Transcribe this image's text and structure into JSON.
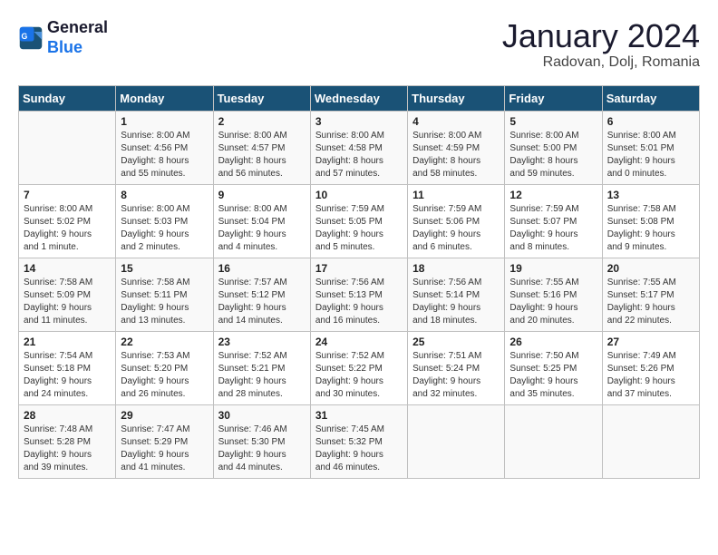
{
  "header": {
    "logo_line1": "General",
    "logo_line2": "Blue",
    "month": "January 2024",
    "location": "Radovan, Dolj, Romania"
  },
  "days_of_week": [
    "Sunday",
    "Monday",
    "Tuesday",
    "Wednesday",
    "Thursday",
    "Friday",
    "Saturday"
  ],
  "weeks": [
    [
      {
        "day": "",
        "info": ""
      },
      {
        "day": "1",
        "info": "Sunrise: 8:00 AM\nSunset: 4:56 PM\nDaylight: 8 hours\nand 55 minutes."
      },
      {
        "day": "2",
        "info": "Sunrise: 8:00 AM\nSunset: 4:57 PM\nDaylight: 8 hours\nand 56 minutes."
      },
      {
        "day": "3",
        "info": "Sunrise: 8:00 AM\nSunset: 4:58 PM\nDaylight: 8 hours\nand 57 minutes."
      },
      {
        "day": "4",
        "info": "Sunrise: 8:00 AM\nSunset: 4:59 PM\nDaylight: 8 hours\nand 58 minutes."
      },
      {
        "day": "5",
        "info": "Sunrise: 8:00 AM\nSunset: 5:00 PM\nDaylight: 8 hours\nand 59 minutes."
      },
      {
        "day": "6",
        "info": "Sunrise: 8:00 AM\nSunset: 5:01 PM\nDaylight: 9 hours\nand 0 minutes."
      }
    ],
    [
      {
        "day": "7",
        "info": "Sunrise: 8:00 AM\nSunset: 5:02 PM\nDaylight: 9 hours\nand 1 minute."
      },
      {
        "day": "8",
        "info": "Sunrise: 8:00 AM\nSunset: 5:03 PM\nDaylight: 9 hours\nand 2 minutes."
      },
      {
        "day": "9",
        "info": "Sunrise: 8:00 AM\nSunset: 5:04 PM\nDaylight: 9 hours\nand 4 minutes."
      },
      {
        "day": "10",
        "info": "Sunrise: 7:59 AM\nSunset: 5:05 PM\nDaylight: 9 hours\nand 5 minutes."
      },
      {
        "day": "11",
        "info": "Sunrise: 7:59 AM\nSunset: 5:06 PM\nDaylight: 9 hours\nand 6 minutes."
      },
      {
        "day": "12",
        "info": "Sunrise: 7:59 AM\nSunset: 5:07 PM\nDaylight: 9 hours\nand 8 minutes."
      },
      {
        "day": "13",
        "info": "Sunrise: 7:58 AM\nSunset: 5:08 PM\nDaylight: 9 hours\nand 9 minutes."
      }
    ],
    [
      {
        "day": "14",
        "info": "Sunrise: 7:58 AM\nSunset: 5:09 PM\nDaylight: 9 hours\nand 11 minutes."
      },
      {
        "day": "15",
        "info": "Sunrise: 7:58 AM\nSunset: 5:11 PM\nDaylight: 9 hours\nand 13 minutes."
      },
      {
        "day": "16",
        "info": "Sunrise: 7:57 AM\nSunset: 5:12 PM\nDaylight: 9 hours\nand 14 minutes."
      },
      {
        "day": "17",
        "info": "Sunrise: 7:56 AM\nSunset: 5:13 PM\nDaylight: 9 hours\nand 16 minutes."
      },
      {
        "day": "18",
        "info": "Sunrise: 7:56 AM\nSunset: 5:14 PM\nDaylight: 9 hours\nand 18 minutes."
      },
      {
        "day": "19",
        "info": "Sunrise: 7:55 AM\nSunset: 5:16 PM\nDaylight: 9 hours\nand 20 minutes."
      },
      {
        "day": "20",
        "info": "Sunrise: 7:55 AM\nSunset: 5:17 PM\nDaylight: 9 hours\nand 22 minutes."
      }
    ],
    [
      {
        "day": "21",
        "info": "Sunrise: 7:54 AM\nSunset: 5:18 PM\nDaylight: 9 hours\nand 24 minutes."
      },
      {
        "day": "22",
        "info": "Sunrise: 7:53 AM\nSunset: 5:20 PM\nDaylight: 9 hours\nand 26 minutes."
      },
      {
        "day": "23",
        "info": "Sunrise: 7:52 AM\nSunset: 5:21 PM\nDaylight: 9 hours\nand 28 minutes."
      },
      {
        "day": "24",
        "info": "Sunrise: 7:52 AM\nSunset: 5:22 PM\nDaylight: 9 hours\nand 30 minutes."
      },
      {
        "day": "25",
        "info": "Sunrise: 7:51 AM\nSunset: 5:24 PM\nDaylight: 9 hours\nand 32 minutes."
      },
      {
        "day": "26",
        "info": "Sunrise: 7:50 AM\nSunset: 5:25 PM\nDaylight: 9 hours\nand 35 minutes."
      },
      {
        "day": "27",
        "info": "Sunrise: 7:49 AM\nSunset: 5:26 PM\nDaylight: 9 hours\nand 37 minutes."
      }
    ],
    [
      {
        "day": "28",
        "info": "Sunrise: 7:48 AM\nSunset: 5:28 PM\nDaylight: 9 hours\nand 39 minutes."
      },
      {
        "day": "29",
        "info": "Sunrise: 7:47 AM\nSunset: 5:29 PM\nDaylight: 9 hours\nand 41 minutes."
      },
      {
        "day": "30",
        "info": "Sunrise: 7:46 AM\nSunset: 5:30 PM\nDaylight: 9 hours\nand 44 minutes."
      },
      {
        "day": "31",
        "info": "Sunrise: 7:45 AM\nSunset: 5:32 PM\nDaylight: 9 hours\nand 46 minutes."
      },
      {
        "day": "",
        "info": ""
      },
      {
        "day": "",
        "info": ""
      },
      {
        "day": "",
        "info": ""
      }
    ]
  ]
}
